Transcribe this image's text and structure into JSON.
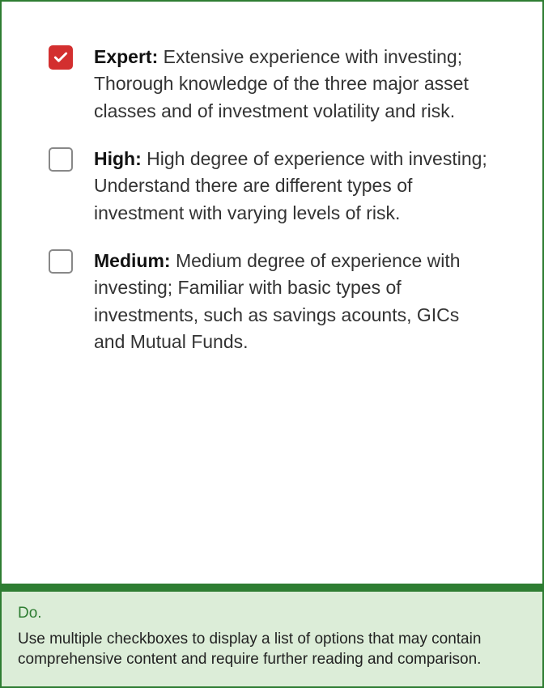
{
  "options": [
    {
      "title": "Expert:",
      "body": " Extensive experience with investing; Thorough knowledge of the three major asset classes and of investment volatility and risk.",
      "checked": true
    },
    {
      "title": "High:",
      "body": " High degree of experience with investing; Understand there are different types of investment with varying levels of risk.",
      "checked": false
    },
    {
      "title": "Medium:",
      "body": " Medium degree of experience with investing; Familiar with basic types of investments, such as savings acounts, GICs and Mutual Funds.",
      "checked": false
    }
  ],
  "footer": {
    "heading": "Do.",
    "body": "Use multiple checkboxes to display a list of options that may contain comprehensive content and require further reading and comparison."
  }
}
